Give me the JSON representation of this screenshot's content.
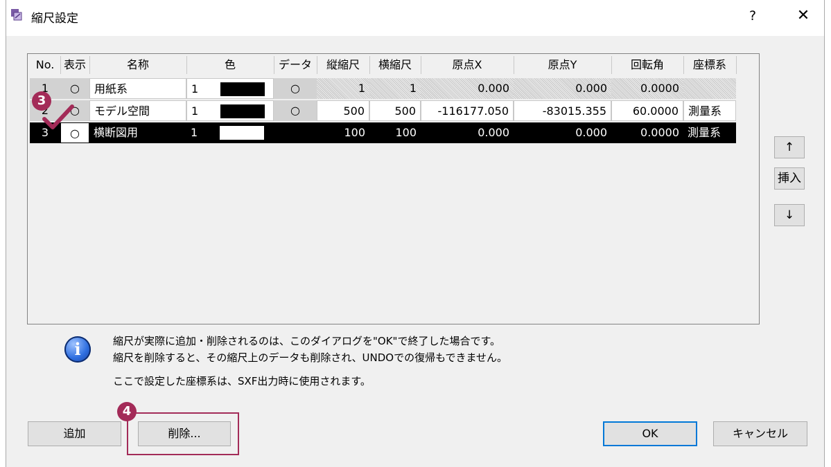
{
  "window": {
    "title": "縮尺設定",
    "help_label": "?",
    "close_label": "✕"
  },
  "table": {
    "headers": [
      "No.",
      "表示",
      "名称",
      "色",
      "データ",
      "縦縮尺",
      "横縮尺",
      "原点X",
      "原点Y",
      "回転角",
      "座標系"
    ],
    "rows": [
      {
        "no": "1",
        "display": "○",
        "name": "用紙系",
        "color_no": "1",
        "swatch": "#000000",
        "data": "○",
        "vscale": "1",
        "hscale": "1",
        "origin_x": "0.000",
        "origin_y": "0.000",
        "rotation": "0.0000",
        "coord": ""
      },
      {
        "no": "2",
        "display": "○",
        "name": "モデル空間",
        "color_no": "1",
        "swatch": "#000000",
        "data": "○",
        "vscale": "500",
        "hscale": "500",
        "origin_x": "-116177.050",
        "origin_y": "-83015.355",
        "rotation": "60.0000",
        "coord": "測量系"
      },
      {
        "no": "3",
        "display": "○",
        "name": "横断図用",
        "color_no": "1",
        "swatch": "#ffffff",
        "data": "",
        "vscale": "100",
        "hscale": "100",
        "origin_x": "0.000",
        "origin_y": "0.000",
        "rotation": "0.0000",
        "coord": "測量系"
      }
    ]
  },
  "side_buttons": {
    "up": "↑",
    "insert": "挿入",
    "down": "↓"
  },
  "notes": {
    "line1": "縮尺が実際に追加・削除されるのは、このダイアログを\"OK\"で終了した場合です。",
    "line2": "縮尺を削除すると、その縮尺上のデータも削除され、UNDOでの復帰もできません。",
    "line3": "ここで設定した座標系は、SXF出力時に使用されます。"
  },
  "buttons": {
    "add": "追加",
    "delete": "削除...",
    "ok": "OK",
    "cancel": "キャンセル"
  },
  "callouts": {
    "step3": "3",
    "step4": "4",
    "accent": "#a32b58"
  },
  "icons": {
    "app": "scale-app-icon",
    "info": "info-icon"
  }
}
